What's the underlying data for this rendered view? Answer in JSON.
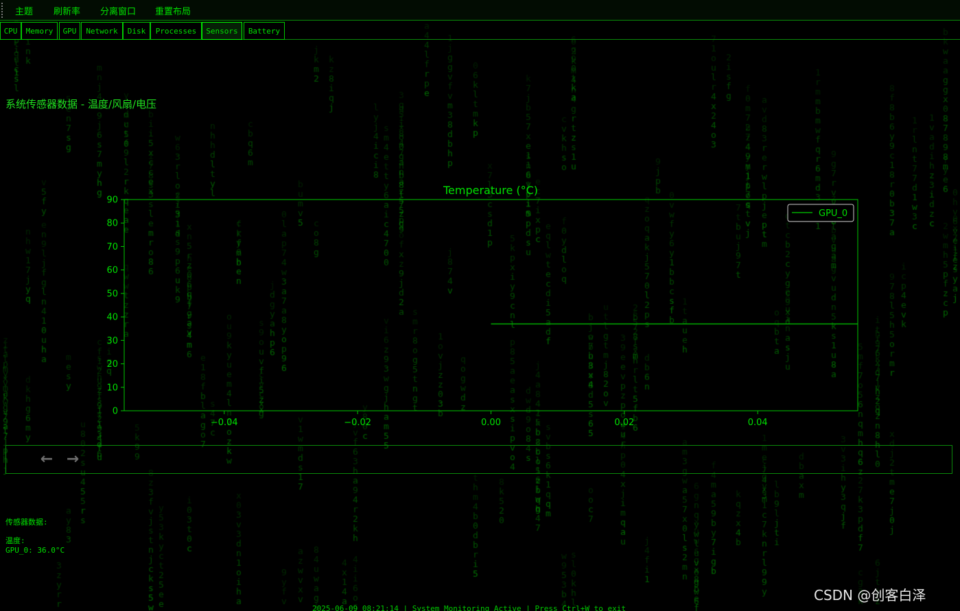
{
  "menu": {
    "items": [
      {
        "label": "主题"
      },
      {
        "label": "刷新率"
      },
      {
        "label": "分离窗口"
      },
      {
        "label": "重置布局"
      }
    ]
  },
  "tabs": [
    {
      "label": "CPU",
      "active": false
    },
    {
      "label": "Memory",
      "active": false
    },
    {
      "label": "GPU",
      "active": false
    },
    {
      "label": "Network",
      "active": false
    },
    {
      "label": "Disk",
      "active": false
    },
    {
      "label": "Processes",
      "active": false
    },
    {
      "label": "Sensors",
      "active": true
    },
    {
      "label": "Battery",
      "active": false
    }
  ],
  "section": {
    "title": "系统传感器数据 - 温度/风扇/电压"
  },
  "chart_data": {
    "type": "line",
    "title": "Temperature (°C)",
    "xlabel": "",
    "ylabel": "",
    "xlim": [
      -0.055,
      0.055
    ],
    "ylim": [
      0,
      90
    ],
    "xticks": [
      -0.04,
      -0.02,
      0.0,
      0.02,
      0.04
    ],
    "xtick_labels": [
      "−0.04",
      "−0.02",
      "0.00",
      "0.02",
      "0.04"
    ],
    "yticks": [
      0,
      10,
      20,
      30,
      40,
      50,
      60,
      70,
      80,
      90
    ],
    "grid": false,
    "legend": "top-right",
    "series": [
      {
        "name": "GPU_0",
        "x": [
          0.0,
          0.055
        ],
        "y": [
          37,
          37
        ],
        "color": "#00aa00"
      }
    ],
    "colors": {
      "axis": "#00c800",
      "text": "#00e000",
      "background": "#000000"
    }
  },
  "nav": {
    "back_icon": "arrow-left-icon",
    "forward_icon": "arrow-right-icon"
  },
  "sensors": {
    "heading": "传感器数据:",
    "temp_heading": "温度:",
    "gpu_line": "GPU_0: 36.0°C"
  },
  "statusbar": {
    "text": "2025-06-09 08:21:14 | System Monitoring Active | Press Ctrl+W to exit"
  },
  "watermark": {
    "text": "CSDN @创客白泽"
  }
}
